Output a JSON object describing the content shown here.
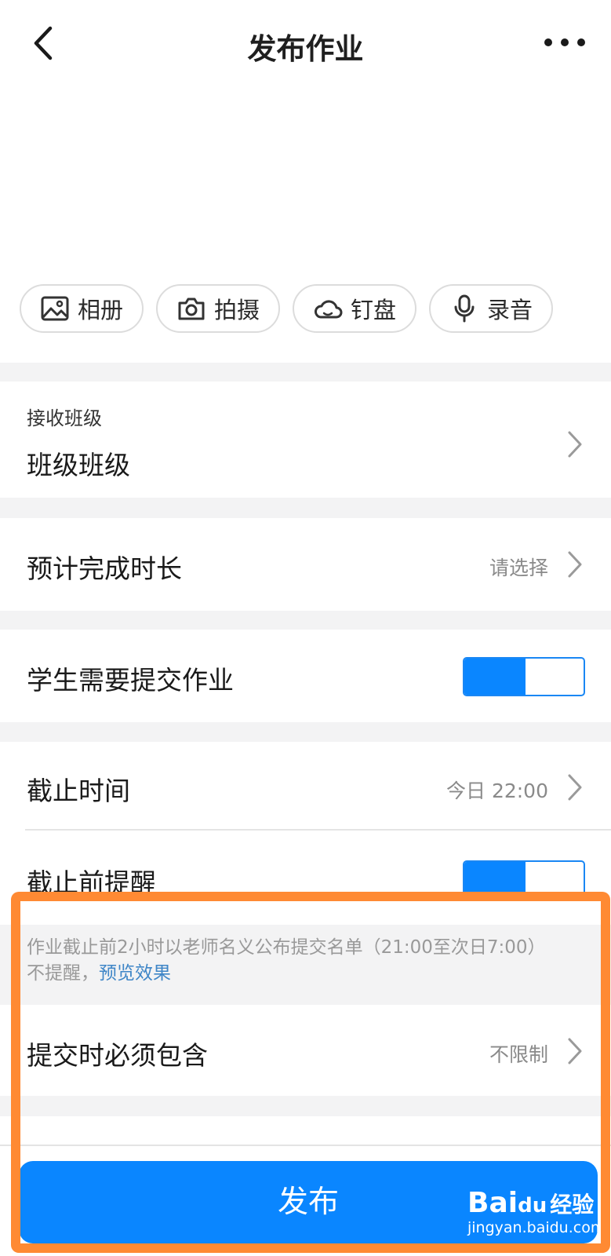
{
  "header": {
    "title": "发布作业"
  },
  "attachments": [
    {
      "label": "相册",
      "icon": "image-icon"
    },
    {
      "label": "拍摄",
      "icon": "camera-icon"
    },
    {
      "label": "钉盘",
      "icon": "cloud-icon"
    },
    {
      "label": "录音",
      "icon": "mic-icon"
    }
  ],
  "receive_class": {
    "label": "接收班级",
    "value": "班级班级"
  },
  "duration": {
    "label": "预计完成时长",
    "value": "请选择"
  },
  "submit_required": {
    "label": "学生需要提交作业",
    "enabled": true
  },
  "deadline": {
    "label": "截止时间",
    "value": "今日 22:00"
  },
  "reminder": {
    "label": "截止前提醒",
    "enabled": true
  },
  "hint": {
    "line1": "作业截止前2小时以老师名义公布提交名单（21:00至次日7:00）",
    "line2_prefix": "不提醒，",
    "preview_link": "预览效果"
  },
  "must_include": {
    "label": "提交时必须包含",
    "value": "不限制"
  },
  "publish_button": "发布",
  "watermark": {
    "main": "Bai",
    "paw": "du",
    "suffix": "经验",
    "sub": "jingyan.baidu.com"
  },
  "colors": {
    "accent": "#0a86ff",
    "highlight": "#ff8a33",
    "link": "#3f86c7"
  }
}
